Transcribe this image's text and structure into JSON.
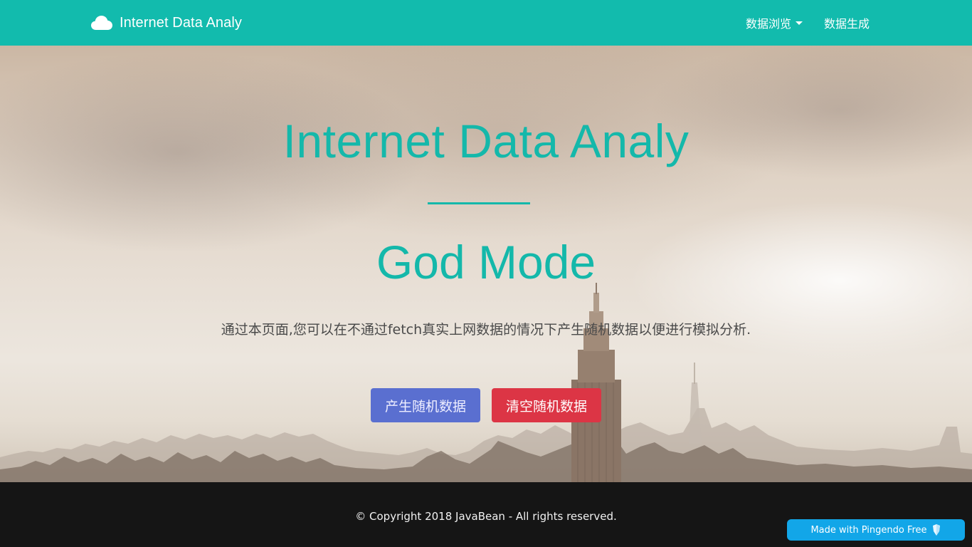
{
  "navbar": {
    "brand": "Internet Data Analy",
    "brand_icon": "cloud-icon",
    "links": [
      {
        "label": "数据浏览",
        "has_dropdown": true
      },
      {
        "label": "数据生成",
        "has_dropdown": false
      }
    ]
  },
  "hero": {
    "title": "Internet Data Analy",
    "subtitle": "God Mode",
    "description": "通过本页面,您可以在不通过fetch真实上网数据的情况下产生随机数据以便进行模拟分析.",
    "buttons": {
      "generate": "产生随机数据",
      "clear": "清空随机数据"
    }
  },
  "footer": {
    "copyright": "© Copyright 2018 JavaBean - All rights reserved."
  },
  "badge": {
    "label": "Made with Pingendo Free",
    "icon": "pingendo-logo-icon"
  },
  "colors": {
    "accent": "#12bbad",
    "primary_button": "#5a6fd0",
    "danger_button": "#dc3545",
    "footer": "#151515",
    "badge": "#12a6e8"
  }
}
